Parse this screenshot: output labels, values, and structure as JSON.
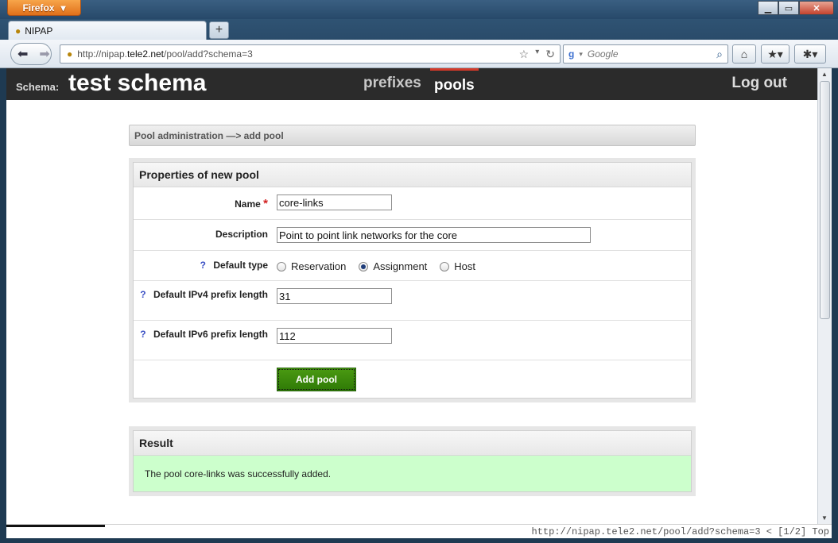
{
  "browser": {
    "menu_button": "Firefox",
    "tab_title": "NIPAP",
    "url_prefix": "http://nipap.",
    "url_host": "tele2.net",
    "url_path": "/pool/add?schema=3",
    "search_placeholder": "Google",
    "status_text": "http://nipap.tele2.net/pool/add?schema=3 < [1/2] Top"
  },
  "header": {
    "schema_label": "Schema:",
    "schema_name": "test schema",
    "nav": {
      "prefixes": "prefixes",
      "pools": "pools"
    },
    "logout": "Log out",
    "active_color": "#d23a2a"
  },
  "breadcrumb": "Pool administration —> add pool",
  "form": {
    "title": "Properties of new pool",
    "name_label": "Name",
    "name_value": "core-links",
    "description_label": "Description",
    "description_value": "Point to point link networks for the core",
    "default_type_label": "Default type",
    "type_options": [
      "Reservation",
      "Assignment",
      "Host"
    ],
    "type_selected": "Assignment",
    "ipv4_label": "Default IPv4 prefix length",
    "ipv4_value": "31",
    "ipv6_label": "Default IPv6 prefix length",
    "ipv6_value": "112",
    "help_glyph": "?",
    "required_glyph": "*",
    "submit_label": "Add pool"
  },
  "result": {
    "title": "Result",
    "message": "The pool core-links was successfully added.",
    "bg_color": "#ccffcc"
  }
}
